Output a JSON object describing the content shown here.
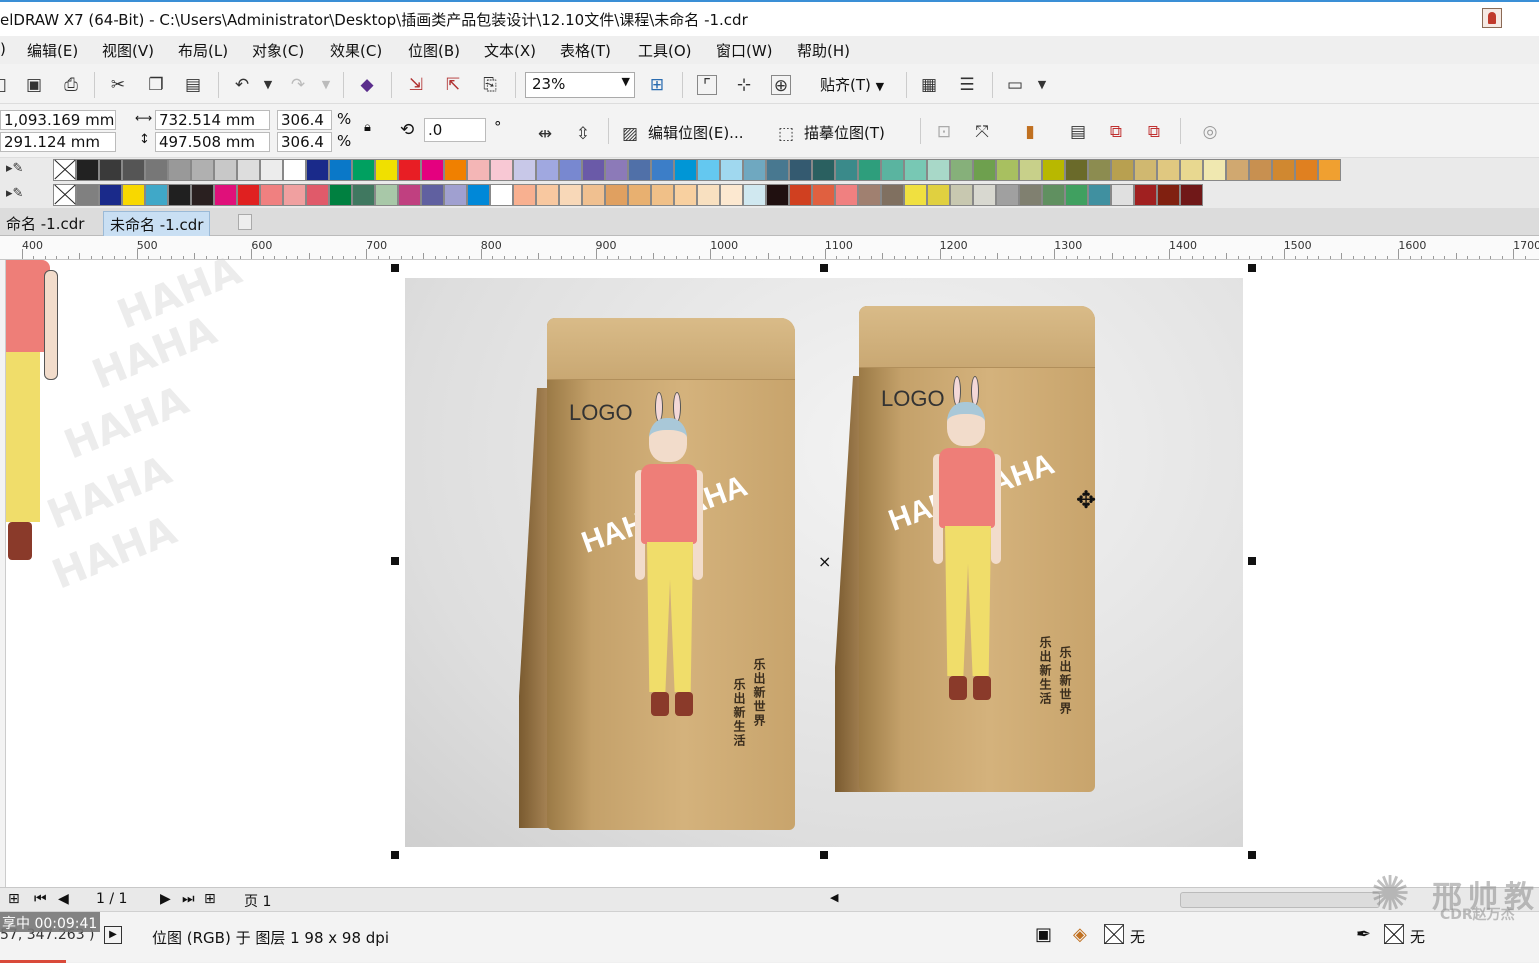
{
  "window": {
    "title": "elDRAW X7 (64-Bit) - C:\\Users\\Administrator\\Desktop\\插画类产品包装设计\\12.10文件\\课程\\未命名 -1.cdr"
  },
  "menu": {
    "items": [
      ")",
      "编辑(E)",
      "视图(V)",
      "布局(L)",
      "对象(C)",
      "效果(C)",
      "位图(B)",
      "文本(X)",
      "表格(T)",
      "工具(O)",
      "窗口(W)",
      "帮助(H)"
    ]
  },
  "toolbar": {
    "zoom": "23%",
    "snap_label": "贴齐(T)"
  },
  "property_bar": {
    "x": "1,093.169 mm",
    "y": "291.124 mm",
    "width": "732.514 mm",
    "height": "497.508 mm",
    "scale_x": "306.4",
    "scale_y": "306.4",
    "percent": "%",
    "angle": ".0",
    "degree": "°",
    "edit_bitmap": "编辑位图(E)...",
    "trace_bitmap": "描摹位图(T)"
  },
  "palette": {
    "row1": [
      "#222222",
      "#3a3a3a",
      "#555555",
      "#777777",
      "#999999",
      "#b0b0b0",
      "#c8c8c8",
      "#dddddd",
      "#ececec",
      "#ffffff",
      "#1a2a8a",
      "#0a78c8",
      "#00a060",
      "#f0e000",
      "#e81e24",
      "#e4007f",
      "#f08000",
      "#f4b6b6",
      "#f8c8d4",
      "#c8c8e8",
      "#a0a8e0",
      "#7888d0",
      "#6a5aa8",
      "#8c7ab8",
      "#5070a8",
      "#3c7ec8",
      "#0096d6",
      "#64c8f0",
      "#a0d8ef",
      "#6fa8c0",
      "#487890",
      "#345a70",
      "#2a6060",
      "#3a8a8a",
      "#2e9e7c",
      "#5ab4a0",
      "#78c8b4",
      "#a8d8c8",
      "#86b07a",
      "#6ea04e",
      "#a8c060",
      "#c8d08a",
      "#b8b800",
      "#6a6a2a",
      "#8c8c50",
      "#b8a050",
      "#d0b870",
      "#e0c880",
      "#e8d890",
      "#f0e8b0",
      "#d0a870",
      "#c89050",
      "#d08830",
      "#e08020",
      "#f0a030"
    ],
    "row2": [
      "#808080",
      "#1a2a8a",
      "#f8d800",
      "#40a8c8",
      "#202020",
      "#2a2020",
      "#e0107a",
      "#e02020",
      "#f08080",
      "#f0a0a0",
      "#e05a6a",
      "#008040",
      "#407860",
      "#a8c8a8",
      "#c04080",
      "#6060a0",
      "#a0a0d0",
      "#0088d8",
      "#ffffff",
      "#f8b090",
      "#f8c8a0",
      "#f8d8b8",
      "#f0c090",
      "#e0a060",
      "#e8b070",
      "#f0c088",
      "#f8d0a0",
      "#f8e0c0",
      "#fce8d0",
      "#d0e8f0",
      "#201010",
      "#d04020",
      "#e06040",
      "#f08080",
      "#a08070",
      "#807060",
      "#f0e040",
      "#e0d040",
      "#c8c8b0",
      "#d8d8d0",
      "#a0a0a0",
      "#808070",
      "#609060",
      "#40a060",
      "#4090a0",
      "#e0e0e0",
      "#a02020",
      "#802010",
      "#701818"
    ]
  },
  "doc_tabs": [
    "命名 -1.cdr",
    "未命名 -1.cdr"
  ],
  "ruler": {
    "labels": [
      "400",
      "500",
      "600",
      "700",
      "800",
      "900",
      "1000",
      "1100",
      "1200",
      "1300",
      "1400",
      "1500",
      "1600",
      "1700"
    ]
  },
  "artwork": {
    "watermark": "HAHA",
    "bag_logo": "LOGO",
    "bag_slogan": "HAHAHAHA",
    "bag_text1": "乐出新世界",
    "bag_text2": "乐出新生活"
  },
  "status": {
    "page_counter": "1 / 1",
    "page_tab": "页 1",
    "recording": "享中 00:09:41",
    "coords": "57, 347.263 )",
    "bitmap_info": "位图 (RGB) 于 图层 1 98 x 98 dpi",
    "fill_none": "无",
    "outline_none": "无"
  },
  "brand": {
    "name": "邢帅教",
    "sub": "CDR赵万杰"
  }
}
